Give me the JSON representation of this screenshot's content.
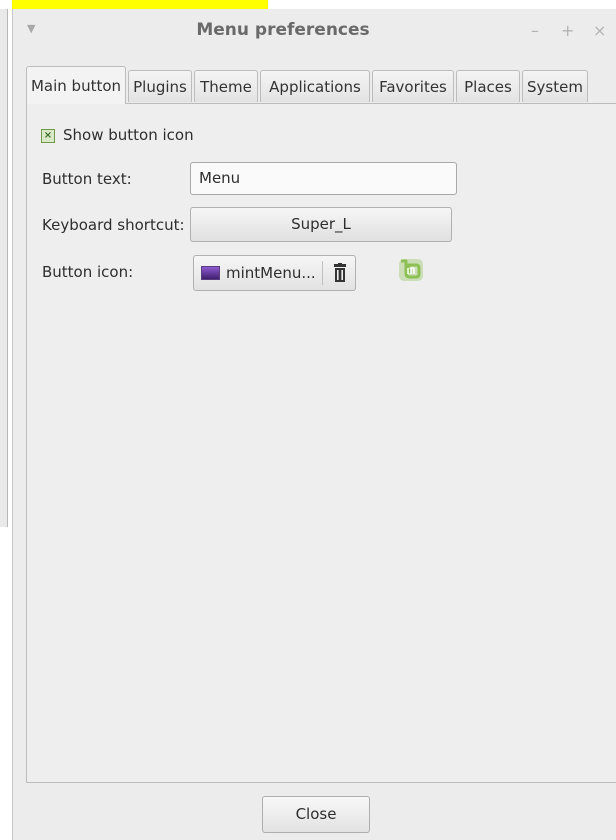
{
  "window": {
    "title": "Menu preferences",
    "menu_glyph": "▼",
    "controls": {
      "minimize": "–",
      "maximize": "+",
      "close": "×"
    }
  },
  "tabs": [
    {
      "label": "Main button",
      "active": true
    },
    {
      "label": "Plugins",
      "active": false
    },
    {
      "label": "Theme",
      "active": false
    },
    {
      "label": "Applications",
      "active": false
    },
    {
      "label": "Favorites",
      "active": false
    },
    {
      "label": "Places",
      "active": false
    },
    {
      "label": "System",
      "active": false
    }
  ],
  "main_button": {
    "show_icon": {
      "label": "Show button icon",
      "checked": true,
      "mark": "×"
    },
    "button_text": {
      "label": "Button text:",
      "value": "Menu"
    },
    "keyboard_shortcut": {
      "label": "Keyboard shortcut:",
      "value": "Super_L"
    },
    "button_icon": {
      "label": "Button icon:",
      "file": "mintMenu..."
    }
  },
  "footer": {
    "close_label": "Close"
  },
  "icons": {
    "window_menu": "chevron-down-icon",
    "file_thumbnail": "image-file-icon",
    "clear": "trash-icon",
    "preview": "linux-mint-logo-icon"
  },
  "colors": {
    "window_bg": "#ececec",
    "checkbox_green": "#6c9a4a",
    "mint_green": "#8cc152",
    "highlight": "#ffff00"
  }
}
